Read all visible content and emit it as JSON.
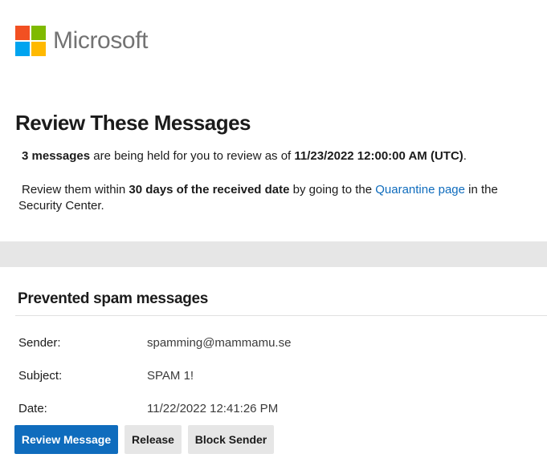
{
  "brand": {
    "name": "Microsoft",
    "colors": [
      "#f25022",
      "#7fba00",
      "#00a4ef",
      "#ffb900"
    ]
  },
  "header": {
    "title": "Review These Messages"
  },
  "summary": {
    "count_text": "3 messages",
    "middle_text": " are being held for you to review as of ",
    "timestamp": "11/23/2022 12:00:00 AM (UTC)",
    "end_text": "."
  },
  "instructions": {
    "prefix": "Review them within ",
    "bold": "30 days of the received date",
    "middle": " by going to the ",
    "link_text": "Quarantine page",
    "suffix": " in the Security Center."
  },
  "section": {
    "title": "Prevented spam messages"
  },
  "message": {
    "sender_label": "Sender:",
    "sender_value": "spamming@mammamu.se",
    "subject_label": "Subject:",
    "subject_value": "SPAM 1!",
    "date_label": "Date:",
    "date_value": "11/22/2022 12:41:26 PM"
  },
  "actions": {
    "review_label": "Review Message",
    "release_label": "Release",
    "block_label": "Block Sender"
  },
  "theme": {
    "accent": "#0f6cbd",
    "band": "#e6e6e6"
  }
}
